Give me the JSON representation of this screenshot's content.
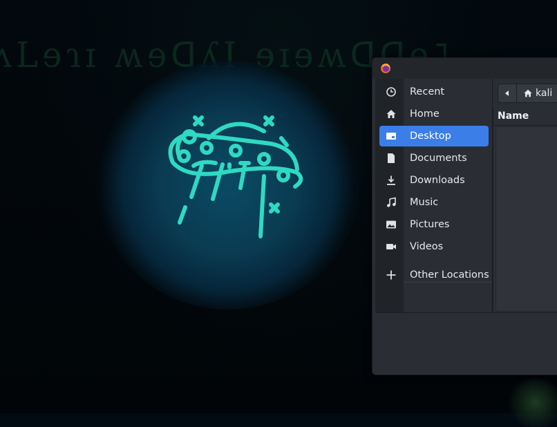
{
  "wallpaper": {
    "background_text": "ʌLɘɿɪ ʍɘᗡʎI ɘɪɘʍᗡᗡɘ˥",
    "accent_color": "#2fd9c2"
  },
  "dialog": {
    "app_icon": "firefox-icon",
    "sidebar": {
      "items": [
        {
          "label": "Recent",
          "icon": "clock-icon",
          "selected": false
        },
        {
          "label": "Home",
          "icon": "home-icon",
          "selected": false
        },
        {
          "label": "Desktop",
          "icon": "desktop-icon",
          "selected": true
        },
        {
          "label": "Documents",
          "icon": "document-icon",
          "selected": false
        },
        {
          "label": "Downloads",
          "icon": "download-icon",
          "selected": false
        },
        {
          "label": "Music",
          "icon": "music-icon",
          "selected": false
        },
        {
          "label": "Pictures",
          "icon": "picture-icon",
          "selected": false
        },
        {
          "label": "Videos",
          "icon": "video-camera-icon",
          "selected": false
        }
      ],
      "other_locations": {
        "label": "Other Locations",
        "icon": "plus-icon"
      }
    },
    "pathbar": {
      "back_icon": "chevron-left-icon",
      "crumb": {
        "label": "kali",
        "icon": "home-icon"
      }
    },
    "file_list": {
      "columns": [
        "Name"
      ]
    },
    "colors": {
      "selection": "#3b7ee8",
      "window_bg": "#2a2d33"
    }
  }
}
